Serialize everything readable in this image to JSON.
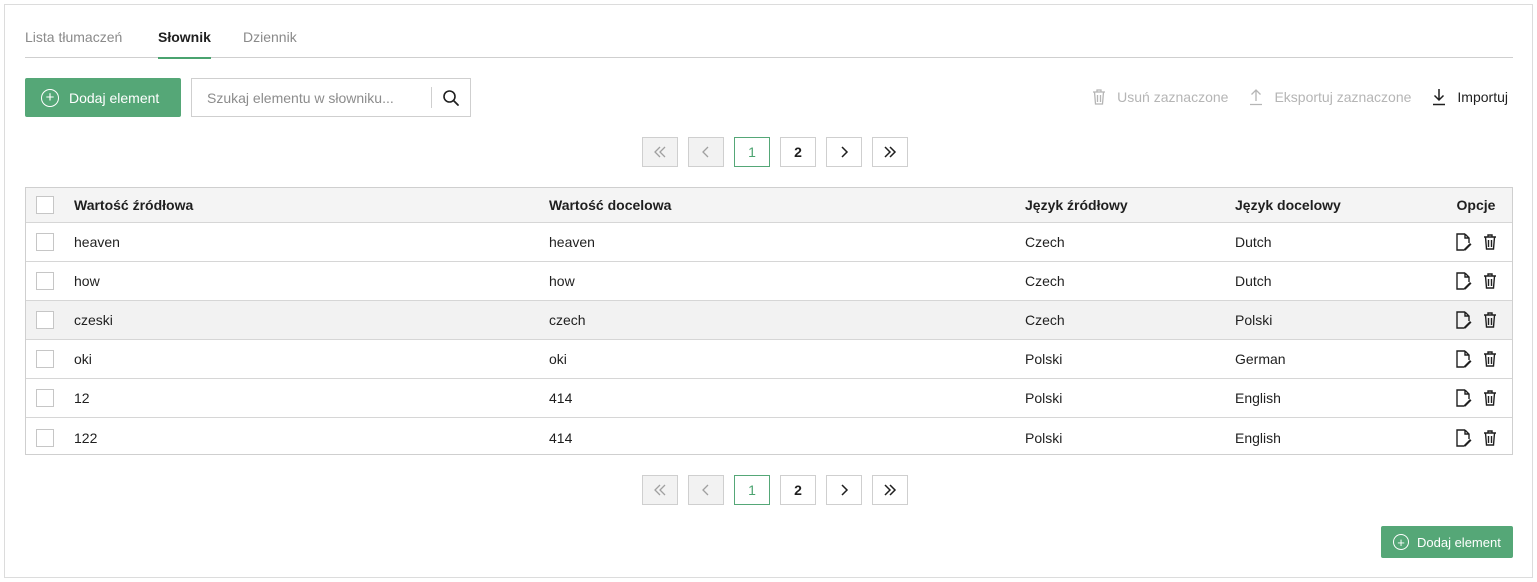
{
  "tabs": [
    {
      "label": "Lista tłumaczeń",
      "active": false
    },
    {
      "label": "Słownik",
      "active": true
    },
    {
      "label": "Dziennik",
      "active": false
    }
  ],
  "toolbar": {
    "add_label": "Dodaj element",
    "search_placeholder": "Szukaj elementu w słowniku...",
    "delete_selected_label": "Usuń zaznaczone",
    "export_selected_label": "Eksportuj zaznaczone",
    "import_label": "Importuj"
  },
  "pagination": {
    "pages": [
      "1",
      "2"
    ],
    "current": "1",
    "first_icon": "double-chevron-left-icon",
    "prev_icon": "chevron-left-icon",
    "next_icon": "chevron-right-icon",
    "last_icon": "double-chevron-right-icon"
  },
  "table": {
    "columns": [
      "Wartość źródłowa",
      "Wartość docelowa",
      "Język źródłowy",
      "Język docelowy",
      "Opcje"
    ],
    "rows": [
      {
        "source": "heaven",
        "target": "heaven",
        "source_lang": "Czech",
        "target_lang": "Dutch"
      },
      {
        "source": "how",
        "target": "how",
        "source_lang": "Czech",
        "target_lang": "Dutch"
      },
      {
        "source": "czeski",
        "target": "czech",
        "source_lang": "Czech",
        "target_lang": "Polski"
      },
      {
        "source": "oki",
        "target": "oki",
        "source_lang": "Polski",
        "target_lang": "German"
      },
      {
        "source": "12",
        "target": "414",
        "source_lang": "Polski",
        "target_lang": "English"
      },
      {
        "source": "122",
        "target": "414",
        "source_lang": "Polski",
        "target_lang": "English"
      }
    ],
    "row_icons": [
      "edit-icon",
      "trash-icon"
    ]
  },
  "bottom": {
    "add_label": "Dodaj element"
  },
  "colors": {
    "accent": "#55a777",
    "disabled_text": "#b5b5b5",
    "header_bg": "#f4f4f4"
  }
}
